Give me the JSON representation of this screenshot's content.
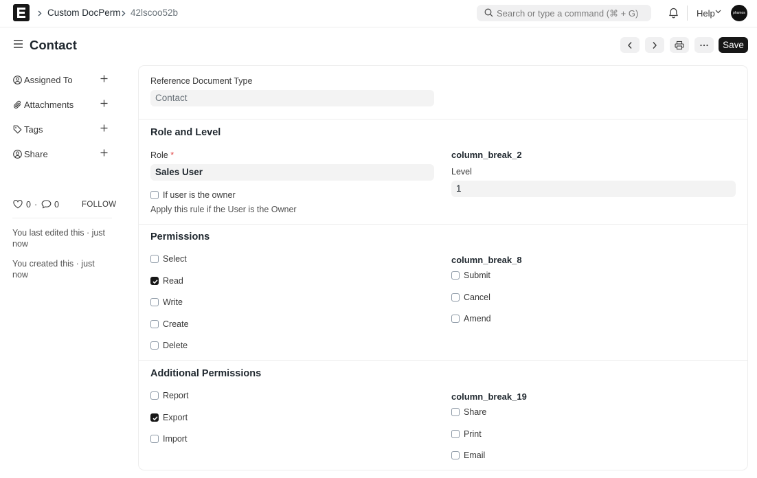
{
  "navbar": {
    "logo_letter": "E",
    "breadcrumbs": [
      "Custom DocPerm",
      "42lscoo52b"
    ],
    "search_placeholder": "Search or type a command (⌘ + G)",
    "help_label": "Help",
    "avatar_text": "phamos"
  },
  "page": {
    "title": "Contact",
    "save_label": "Save"
  },
  "sidebar": {
    "items": [
      {
        "label": "Assigned To",
        "icon": "assign-icon"
      },
      {
        "label": "Attachments",
        "icon": "paperclip-icon"
      },
      {
        "label": "Tags",
        "icon": "tag-icon"
      },
      {
        "label": "Share",
        "icon": "share-icon"
      }
    ],
    "likes": "0",
    "dot": "·",
    "comments": "0",
    "follow_label": "FOLLOW",
    "last_edited": "You last edited this · just now",
    "created": "You created this · just now"
  },
  "form": {
    "ref_doctype_label": "Reference Document Type",
    "ref_doctype_value": "Contact",
    "role_level_title": "Role and Level",
    "role_label": "Role",
    "role_required": "*",
    "role_value": "Sales User",
    "column_break_2": "column_break_2",
    "level_label": "Level",
    "level_value": "1",
    "if_owner_label": "If user is the owner",
    "if_owner_desc": "Apply this rule if the User is the Owner",
    "permissions_title": "Permissions",
    "column_break_8": "column_break_8",
    "permissions_left": [
      {
        "label": "Select",
        "checked": false
      },
      {
        "label": "Read",
        "checked": true
      },
      {
        "label": "Write",
        "checked": false
      },
      {
        "label": "Create",
        "checked": false
      },
      {
        "label": "Delete",
        "checked": false
      }
    ],
    "permissions_right": [
      {
        "label": "Submit",
        "checked": false
      },
      {
        "label": "Cancel",
        "checked": false
      },
      {
        "label": "Amend",
        "checked": false
      }
    ],
    "additional_title": "Additional Permissions",
    "column_break_19": "column_break_19",
    "additional_left": [
      {
        "label": "Report",
        "checked": false
      },
      {
        "label": "Export",
        "checked": true
      },
      {
        "label": "Import",
        "checked": false
      }
    ],
    "additional_right": [
      {
        "label": "Share",
        "checked": false
      },
      {
        "label": "Print",
        "checked": false
      },
      {
        "label": "Email",
        "checked": false
      }
    ]
  },
  "colors": {
    "primary_dark": "#171717",
    "control_bg": "#f3f3f3",
    "border": "#ededed",
    "required": "#e24c4c"
  }
}
